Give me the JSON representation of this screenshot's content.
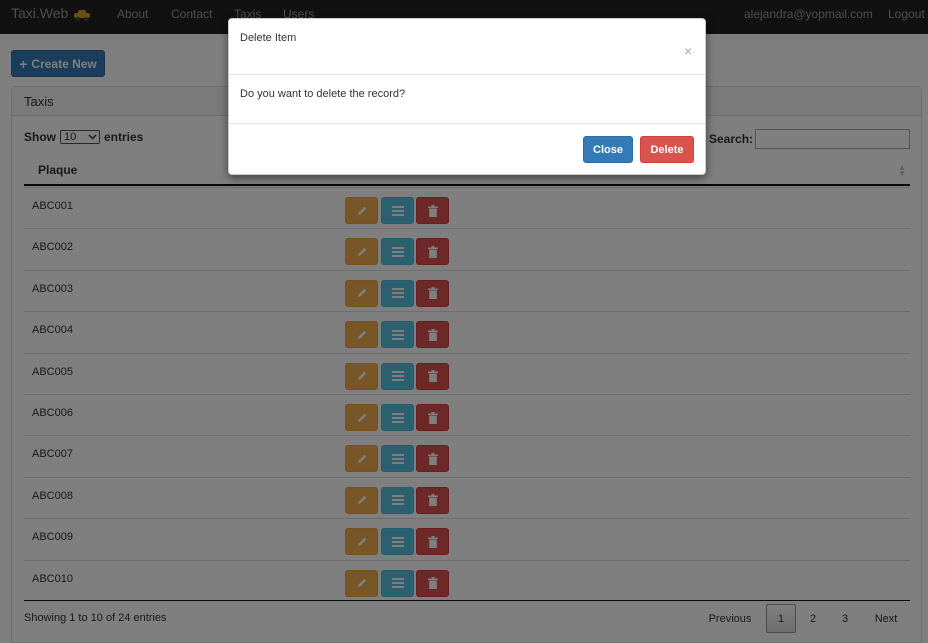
{
  "navbar": {
    "brand": "Taxi.Web",
    "brand_icon": "taxi-icon",
    "links": {
      "about": "About",
      "contact": "Contact",
      "taxis": "Taxis",
      "users": "Users"
    },
    "user": "alejandra@yopmail.com",
    "logout": "Logout"
  },
  "toolbar": {
    "create_label": "Create New",
    "create_icon": "plus-icon"
  },
  "panel": {
    "title": "Taxis"
  },
  "table_controls": {
    "show_label": "Show",
    "page_size": "10",
    "entries_label": "entries",
    "search_label": "Search:",
    "search_value": ""
  },
  "table": {
    "columns": [
      "Plaque"
    ],
    "rows": [
      {
        "plaque": "ABC001"
      },
      {
        "plaque": "ABC002"
      },
      {
        "plaque": "ABC003"
      },
      {
        "plaque": "ABC004"
      },
      {
        "plaque": "ABC005"
      },
      {
        "plaque": "ABC006"
      },
      {
        "plaque": "ABC007"
      },
      {
        "plaque": "ABC008"
      },
      {
        "plaque": "ABC009"
      },
      {
        "plaque": "ABC010"
      }
    ],
    "row_actions": [
      "edit-icon",
      "details-icon",
      "delete-icon"
    ]
  },
  "footer": {
    "info": "Showing 1 to 10 of 24 entries",
    "pagination": {
      "previous": "Previous",
      "pages": [
        "1",
        "2",
        "3"
      ],
      "current": "1",
      "next": "Next"
    }
  },
  "modal": {
    "title": "Delete Item",
    "close_symbol": "×",
    "body": "Do you want to delete the record?",
    "close_label": "Close",
    "delete_label": "Delete"
  },
  "colors": {
    "primary": "#337ab7",
    "warning": "#f0ad4e",
    "info": "#5bc0de",
    "danger": "#d9534f",
    "navbar": "#222222"
  }
}
